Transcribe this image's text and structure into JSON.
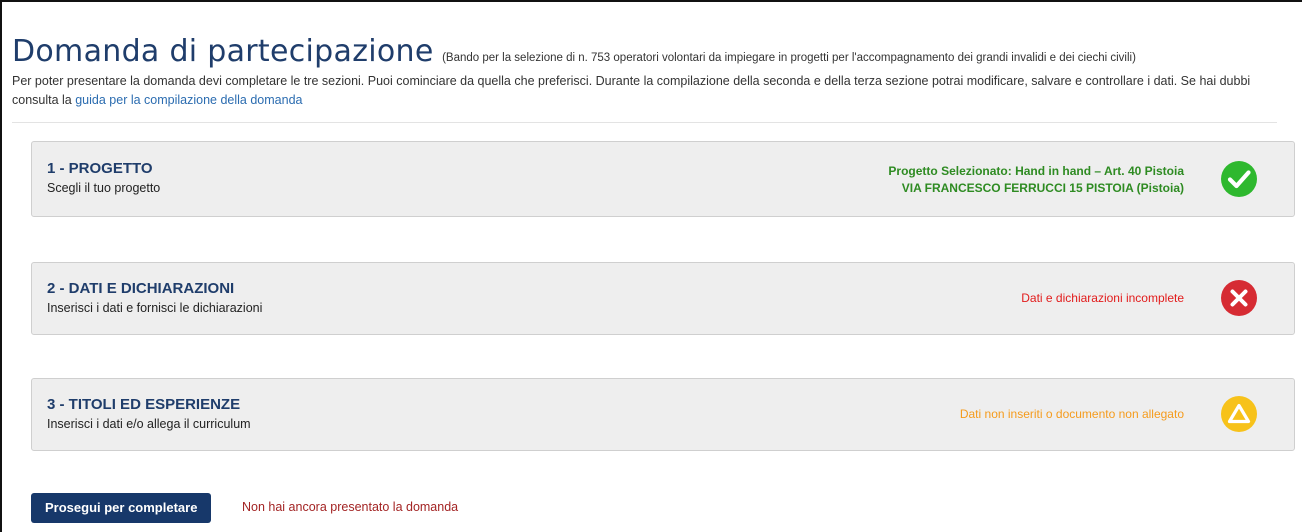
{
  "header": {
    "title": "Domanda di partecipazione",
    "subtitle": "(Bando per la selezione di n. 753 operatori volontari da impiegare in progetti per l'accompagnamento dei grandi invalidi e dei ciechi civili)"
  },
  "intro": {
    "text": "Per poter presentare la domanda devi completare le tre sezioni. Puoi cominciare da quella che preferisci. Durante la compilazione della seconda e della terza sezione potrai modificare, salvare e controllare i dati. Se hai dubbi consulta la ",
    "link_label": "guida per la compilazione della domanda"
  },
  "sections": [
    {
      "title": "1 - PROGETTO",
      "description": "Scegli il tuo progetto",
      "status_line1": "Progetto Selezionato: Hand in hand – Art. 40 Pistoia",
      "status_line2": "VIA FRANCESCO FERRUCCI 15 PISTOIA (Pistoia)",
      "state": "complete",
      "icon": "check-circle-icon",
      "color": "#2eb82e"
    },
    {
      "title": "2 - DATI E DICHIARAZIONI",
      "description": "Inserisci i dati e fornisci le dichiarazioni",
      "status_line1": "Dati e dichiarazioni incomplete",
      "state": "error",
      "icon": "x-circle-icon",
      "color": "#d62b33"
    },
    {
      "title": "3 - TITOLI ED ESPERIENZE",
      "description": "Inserisci i dati e/o allega il curriculum",
      "status_line1": "Dati non inseriti o documento non allegato",
      "state": "warning",
      "icon": "warning-triangle-icon",
      "color": "#f7c21a"
    }
  ],
  "footer": {
    "button_label": "Prosegui per completare",
    "notice": "Non hai ancora presentato la domanda"
  }
}
